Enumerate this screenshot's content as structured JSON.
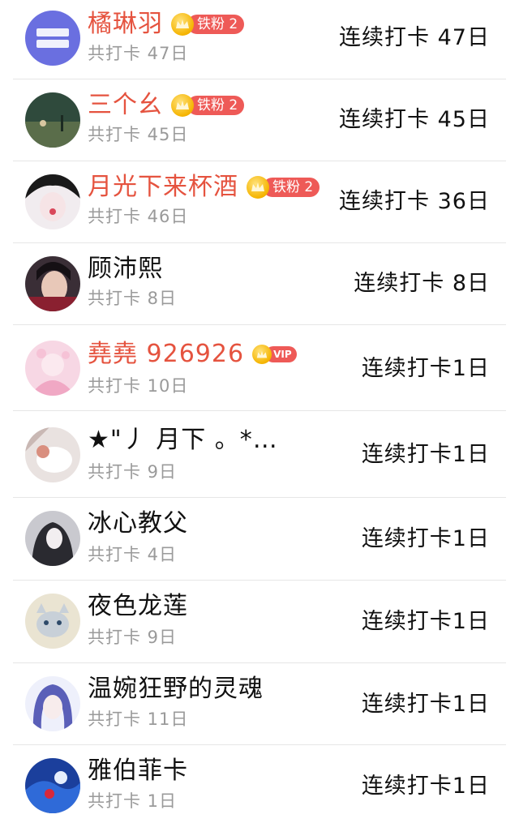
{
  "colors": {
    "vip_name": "#e5533f",
    "normal_name": "#111111",
    "sub_text": "#9a9a9a",
    "badge_red": "#ee5a57",
    "badge_gold": "#f5b400",
    "divider": "#e6e6e6"
  },
  "rows": [
    {
      "name": "橘琳羽",
      "sub": "共打卡 47日",
      "streak": "连续打卡 47日",
      "badge": "铁粉 2",
      "avatar_icon": "logo-avatar"
    },
    {
      "name": "三个幺",
      "sub": "共打卡 45日",
      "streak": "连续打卡 45日",
      "badge": "铁粉 2",
      "avatar_icon": "scene-avatar"
    },
    {
      "name": "月光下来杯酒",
      "sub": "共打卡 46日",
      "streak": "连续打卡 36日",
      "badge": "铁粉 2",
      "avatar_icon": "anime-girl-avatar"
    },
    {
      "name": "顾沛熙",
      "sub": "共打卡 8日",
      "streak": "连续打卡 8日",
      "badge": "",
      "avatar_icon": "portrait-avatar"
    },
    {
      "name": "堯堯 926926",
      "sub": "共打卡 10日",
      "streak": "连续打卡1日",
      "badge": "VIP",
      "avatar_icon": "pink-anime-avatar"
    },
    {
      "name": "★\"丿 月下 。*…",
      "sub": "共打卡 9日",
      "streak": "连续打卡1日",
      "badge": "",
      "avatar_icon": "fox-avatar"
    },
    {
      "name": "冰心教父",
      "sub": "共打卡 4日",
      "streak": "连续打卡1日",
      "badge": "",
      "avatar_icon": "dark-anime-avatar"
    },
    {
      "name": "夜色龙莲",
      "sub": "共打卡 9日",
      "streak": "连续打卡1日",
      "badge": "",
      "avatar_icon": "cat-avatar"
    },
    {
      "name": "温婉狂野的灵魂",
      "sub": "共打卡 11日",
      "streak": "连续打卡1日",
      "badge": "",
      "avatar_icon": "blue-hair-avatar"
    },
    {
      "name": "雅伯菲卡",
      "sub": "共打卡 1日",
      "streak": "连续打卡1日",
      "badge": "",
      "avatar_icon": "blue-anime-avatar"
    }
  ]
}
